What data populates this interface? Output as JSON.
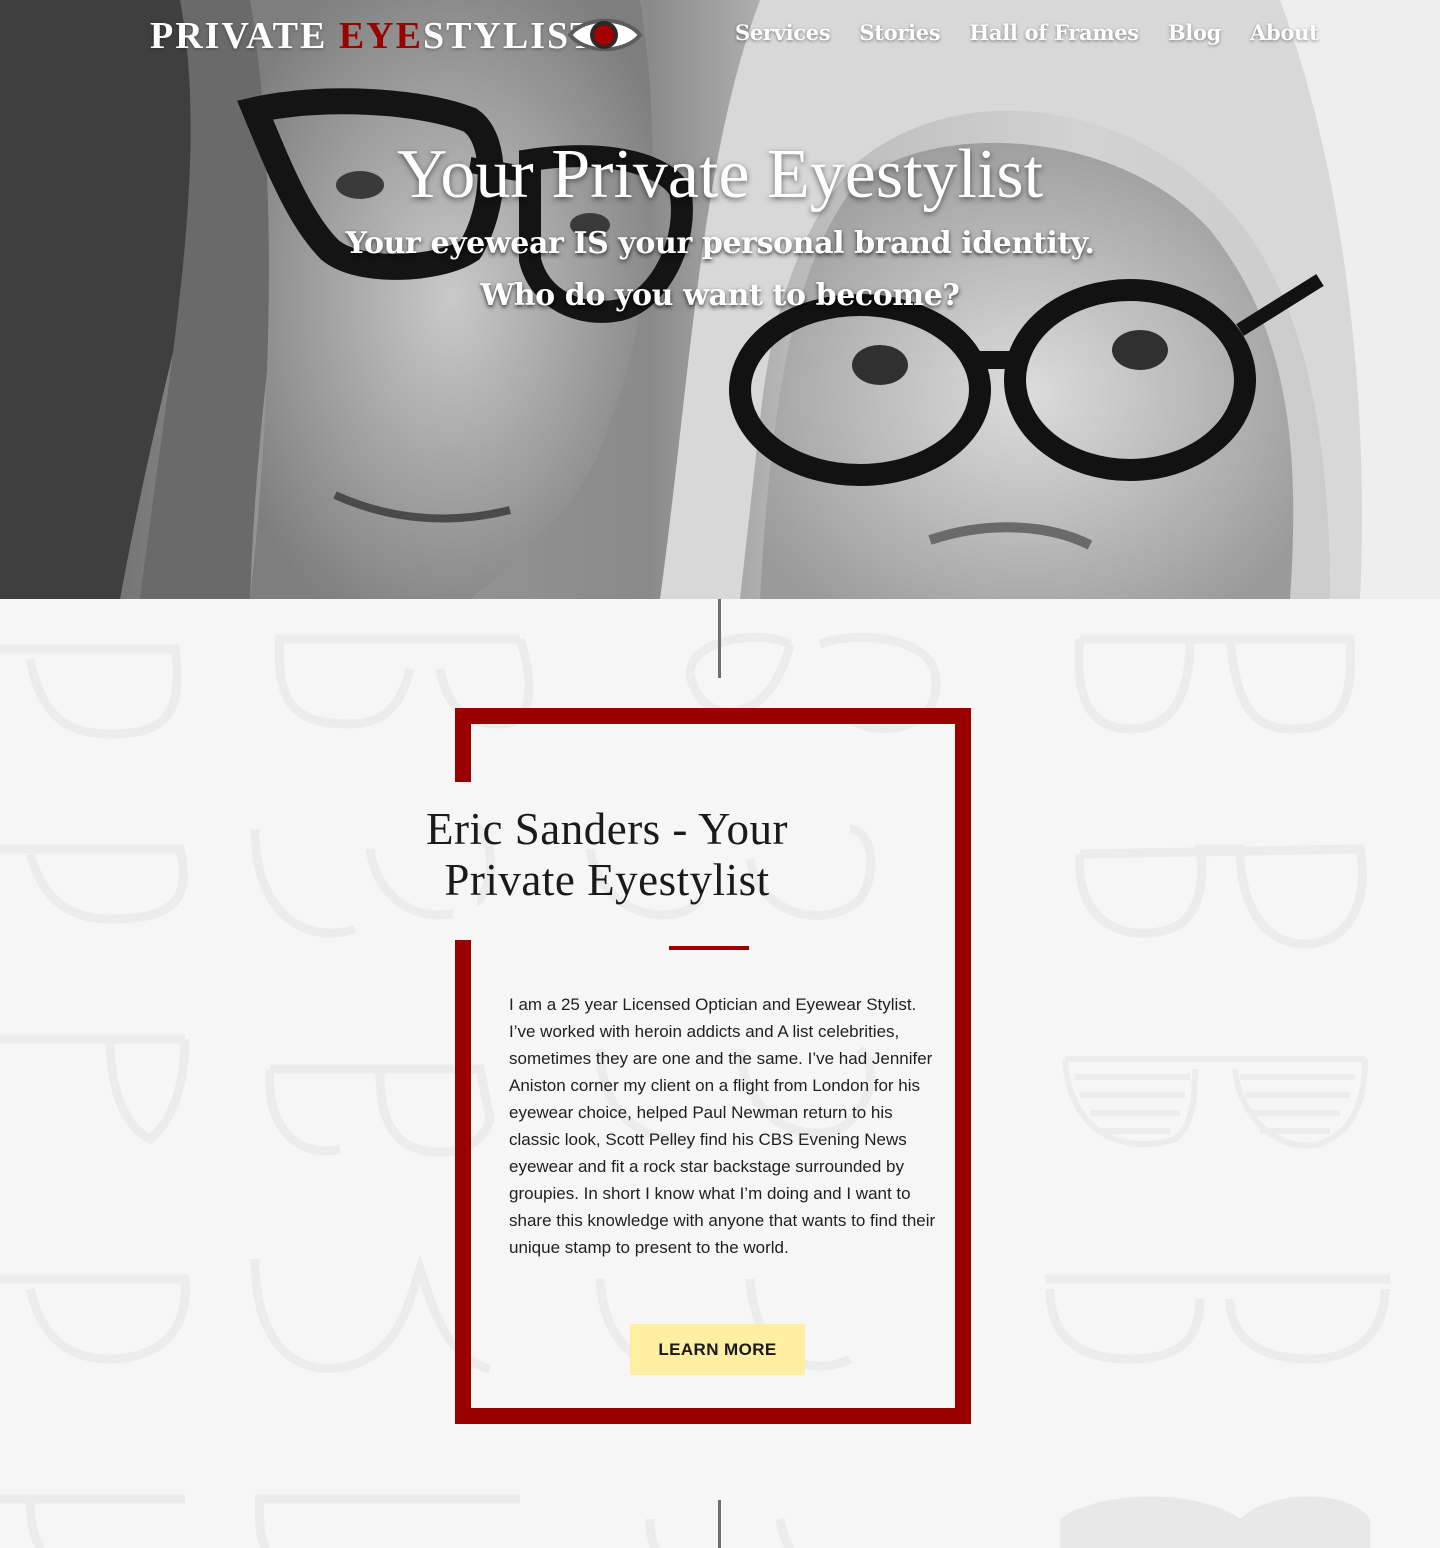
{
  "brand": {
    "logo_part1": "PRIVATE ",
    "logo_part2": "EYE",
    "logo_part3": "STYLIST",
    "logo_icon": "eye-icon",
    "accent_color": "#9b0000"
  },
  "nav": {
    "items": [
      {
        "label": "Services"
      },
      {
        "label": "Stories"
      },
      {
        "label": "Hall of Frames"
      },
      {
        "label": "Blog"
      },
      {
        "label": "About"
      }
    ]
  },
  "hero": {
    "title": "Your Private Eyestylist",
    "subtitle_line1": "Your eyewear IS your personal brand identity.",
    "subtitle_line2": "Who do you want to become?"
  },
  "bio": {
    "title": "Eric Sanders - Your Private Eyestylist",
    "body": "I am a 25 year Licensed Optician and Eyewear Stylist. I’ve worked with heroin addicts and A list celebrities, sometimes they are one and the same. I’ve had Jennifer Aniston corner my client on a flight from London for his eyewear choice, helped Paul Newman return to his classic look, Scott Pelley find his CBS Evening News eyewear and fit a rock star backstage surrounded by groupies. In short I know what I’m doing and I want to share this knowledge with anyone that wants to find their unique stamp to present to the world.",
    "button_label": "LEARN MORE",
    "button_color": "#fdeea1"
  }
}
